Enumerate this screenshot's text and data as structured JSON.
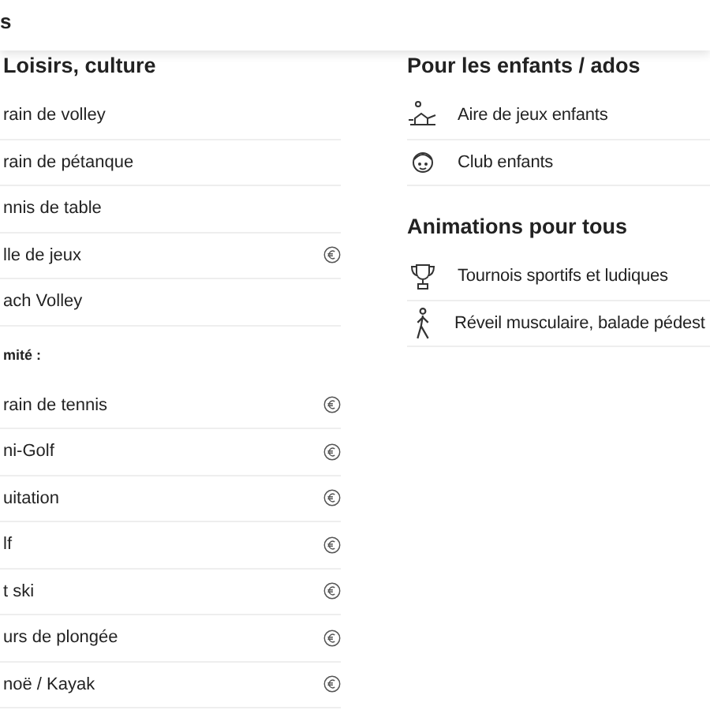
{
  "header": {
    "title": "s"
  },
  "left": {
    "title": "Loisirs, culture",
    "items": [
      {
        "label": "rain de volley",
        "paid": false
      },
      {
        "label": "rain de pétanque",
        "paid": false
      },
      {
        "label": "nnis de table",
        "paid": false
      },
      {
        "label": "lle de jeux",
        "paid": true
      },
      {
        "label": "ach Volley",
        "paid": false
      }
    ],
    "subtitle": "mité :",
    "nearby": [
      {
        "label": "rain de tennis",
        "paid": true
      },
      {
        "label": "ni-Golf",
        "paid": true
      },
      {
        "label": "uitation",
        "paid": true
      },
      {
        "label": "lf",
        "paid": true
      },
      {
        "label": "t ski",
        "paid": true
      },
      {
        "label": "urs de plongée",
        "paid": true
      },
      {
        "label": "noë / Kayak",
        "paid": true
      }
    ]
  },
  "right": [
    {
      "title": "Pour les enfants / ados",
      "items": [
        {
          "label": "Aire de jeux enfants",
          "kind": "playground"
        },
        {
          "label": "Club enfants",
          "kind": "kids"
        }
      ]
    },
    {
      "title": "Animations pour tous",
      "items": [
        {
          "label": "Tournois sportifs et ludiques",
          "kind": "trophy"
        },
        {
          "label": "Réveil musculaire, balade pédest",
          "kind": "walker"
        }
      ]
    }
  ]
}
